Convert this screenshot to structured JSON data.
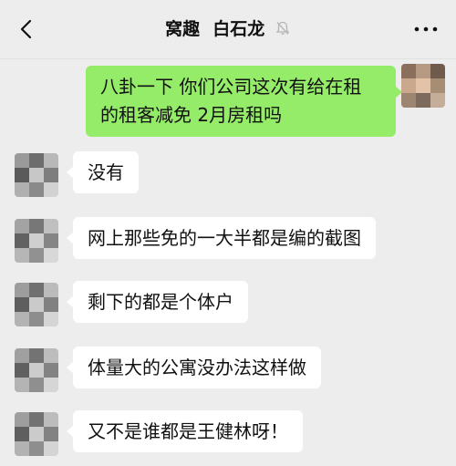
{
  "header": {
    "name_part1": "窝趣",
    "name_part2": "白石龙",
    "back_icon": "chevron-left-icon",
    "mute_icon": "muted-bell-icon",
    "more_icon": "more-dots-icon"
  },
  "messages": [
    {
      "from": "self",
      "lines": [
        "八卦一下  你们公司这次有给在租",
        "的租客减免 2月房租吗"
      ]
    },
    {
      "from": "other",
      "text": "没有"
    },
    {
      "from": "other",
      "text": "网上那些免的一大半都是编的截图"
    },
    {
      "from": "other",
      "text": "剩下的都是个体户"
    },
    {
      "from": "other",
      "text": "体量大的公寓没办法这样做"
    },
    {
      "from": "other",
      "text": "又不是谁都是王健林呀！"
    }
  ],
  "colors": {
    "background": "#ededed",
    "sent_bubble": "#95ec69",
    "received_bubble": "#ffffff"
  }
}
